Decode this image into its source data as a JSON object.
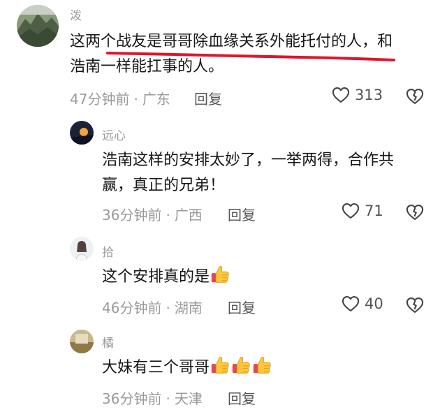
{
  "comments": [
    {
      "username": "泼",
      "content_line1": "这两个战友是哥哥除血缘关系外能托付的人，和",
      "content_line2": "浩南一样能扛事的人。",
      "time": "47分钟前",
      "location": "广东",
      "reply_label": "回复",
      "likes": "313"
    },
    {
      "username": "远心",
      "content_line1": "浩南这样的安排太妙了，一举两得，合作共",
      "content_line2": "赢，真正的兄弟！",
      "time": "36分钟前",
      "location": "广西",
      "reply_label": "回复",
      "likes": "71"
    },
    {
      "username": "拾",
      "content_line1": "这个安排真的是",
      "time": "46分钟前",
      "location": "湖南",
      "reply_label": "回复",
      "likes": "40"
    },
    {
      "username": "橘",
      "content_line1": "大妹有三个哥哥",
      "time": "36分钟前",
      "location": "天津",
      "reply_label": "回复"
    }
  ],
  "colors": {
    "underline": "#e0152a",
    "muted": "#9a9a9a",
    "text": "#161616"
  },
  "icons": {
    "like": "heart-outline-icon",
    "dislike": "broken-heart-icon",
    "emoji": "thumbs-up-emoji"
  }
}
